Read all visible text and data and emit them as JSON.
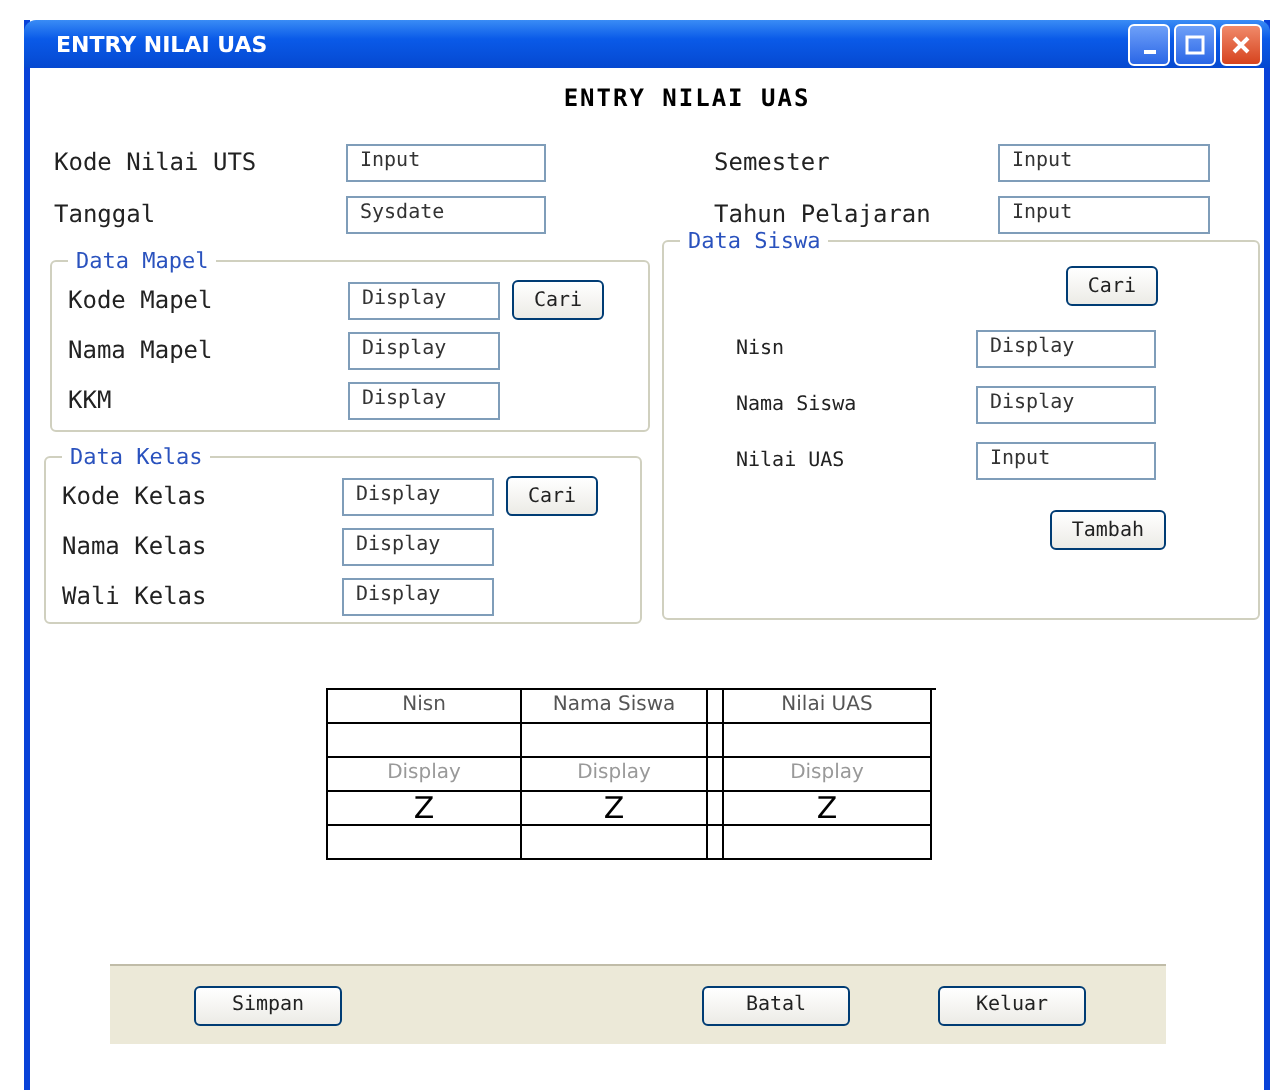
{
  "window": {
    "title": "ENTRY NILAI UAS"
  },
  "heading": "ENTRY NILAI UAS",
  "top_left": [
    {
      "label": "Kode Nilai UTS",
      "value": "Input"
    },
    {
      "label": "Tanggal",
      "value": "Sysdate"
    }
  ],
  "top_right": [
    {
      "label": "Semester",
      "value": "Input"
    },
    {
      "label": "Tahun Pelajaran",
      "value": "Input"
    }
  ],
  "data_mapel": {
    "title": "Data Mapel",
    "fields": [
      {
        "label": "Kode Mapel",
        "value": "Display"
      },
      {
        "label": "Nama Mapel",
        "value": "Display"
      },
      {
        "label": "KKM",
        "value": "Display"
      }
    ],
    "button": "Cari"
  },
  "data_kelas": {
    "title": "Data Kelas",
    "fields": [
      {
        "label": "Kode Kelas",
        "value": "Display"
      },
      {
        "label": "Nama Kelas",
        "value": "Display"
      },
      {
        "label": "Wali Kelas",
        "value": "Display"
      }
    ],
    "button": "Cari"
  },
  "data_siswa": {
    "title": "Data Siswa",
    "button": "Cari",
    "fields": [
      {
        "label": "Nisn",
        "value": "Display"
      },
      {
        "label": "Nama Siswa",
        "value": "Display"
      },
      {
        "label": "Nilai UAS",
        "value": "Input"
      }
    ],
    "add_button": "Tambah"
  },
  "table": {
    "columns": [
      "Nisn",
      "Nama Siswa",
      "Nilai UAS"
    ],
    "rows": [
      [
        "",
        "",
        ""
      ],
      [
        "Display",
        "Display",
        "Display"
      ],
      [
        "Z",
        "Z",
        "Z"
      ]
    ]
  },
  "buttons": [
    {
      "label": "Simpan"
    },
    {
      "label": "Batal"
    },
    {
      "label": "Keluar"
    }
  ]
}
